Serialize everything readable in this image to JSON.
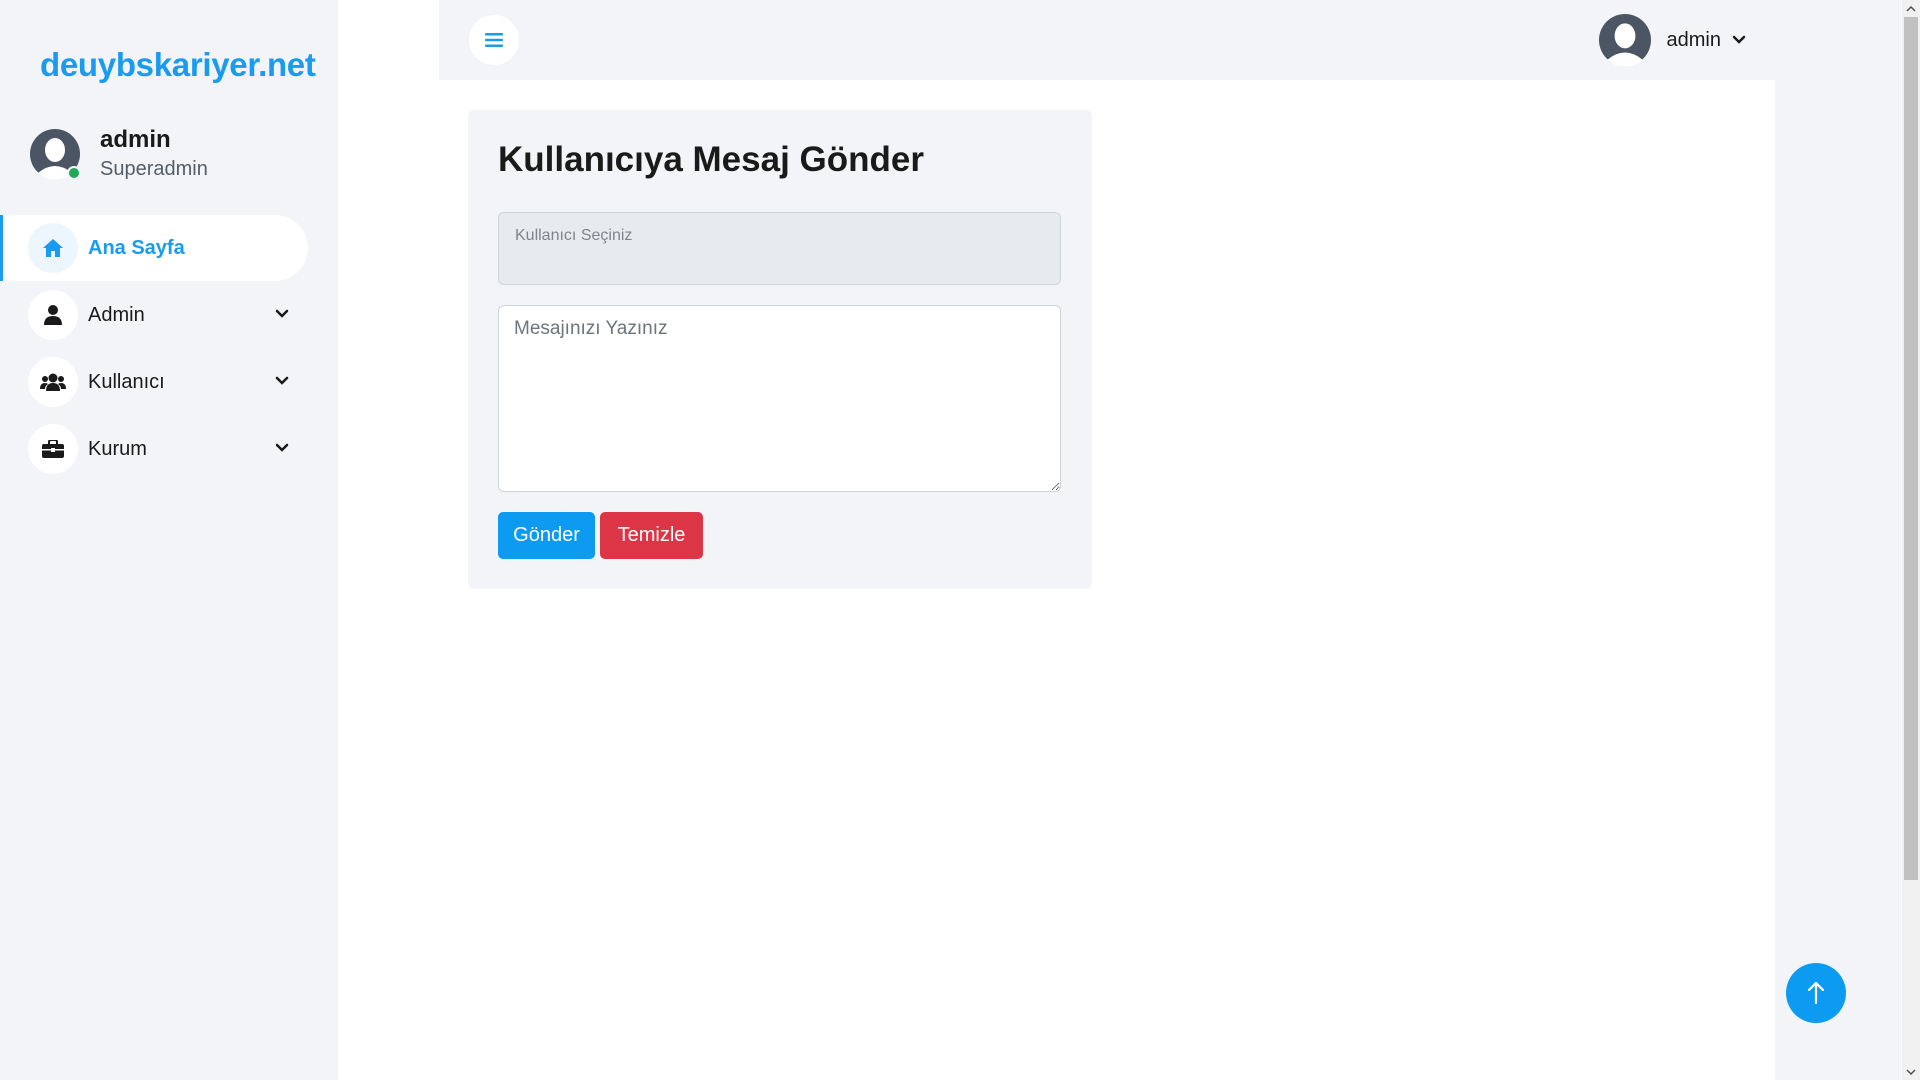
{
  "sidebar": {
    "brand": "deuybskariyer.net",
    "profile": {
      "name": "admin",
      "role": "Superadmin",
      "avatar_icon": "user-avatar-icon",
      "status_color": "#22a65a"
    },
    "items": [
      {
        "label": "Ana Sayfa",
        "icon": "home-icon",
        "active": true
      },
      {
        "label": "Admin",
        "icon": "user-icon",
        "expandable": true
      },
      {
        "label": "Kullanıcı",
        "icon": "users-icon",
        "expandable": true
      },
      {
        "label": "Kurum",
        "icon": "briefcase-icon",
        "expandable": true
      }
    ]
  },
  "topbar": {
    "menu_icon": "hamburger-icon",
    "user": {
      "name": "admin",
      "avatar_icon": "user-avatar-icon"
    }
  },
  "form": {
    "title": "Kullanıcıya Mesaj Gönder",
    "user_select_placeholder": "Kullanıcı Seçiniz",
    "message_placeholder": "Mesajınızı Yazınız",
    "send_label": "Gönder",
    "clear_label": "Temizle"
  },
  "colors": {
    "accent": "#1a9bf0",
    "button_primary": "#0d9bf2",
    "button_danger": "#dc3545",
    "sidebar_bg": "#f2f4f7"
  },
  "scroll_top_icon": "arrow-up-icon"
}
